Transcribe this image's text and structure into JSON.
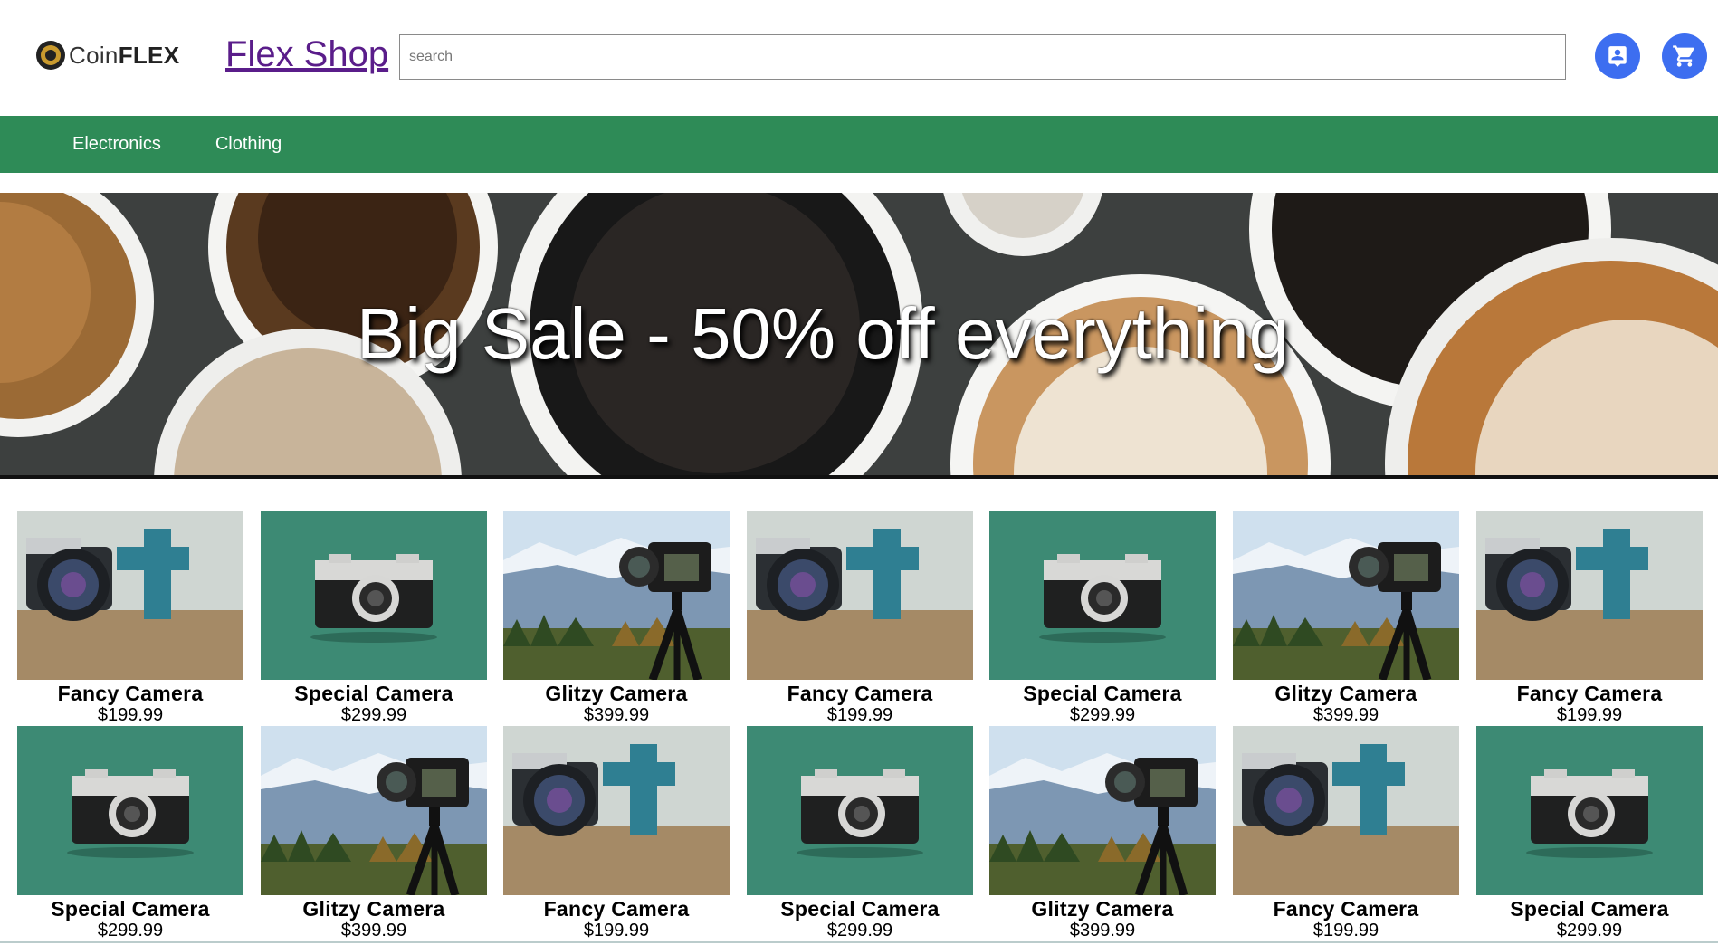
{
  "header": {
    "logo_text_light": "Coin",
    "logo_text_bold": "FLEX",
    "shop_title": "Flex Shop",
    "search_placeholder": "search",
    "account_icon": "account-icon",
    "cart_icon": "cart-icon"
  },
  "nav": {
    "items": [
      {
        "label": "Electronics"
      },
      {
        "label": "Clothing"
      }
    ]
  },
  "banner": {
    "headline": "Big Sale - 50% off everything"
  },
  "colors": {
    "nav_green": "#2e8b57",
    "icon_blue": "#3d6ef0",
    "title_purple": "#5a1d8a"
  },
  "products": [
    {
      "name": "Fancy Camera",
      "price": "$199.99",
      "image": "fancy"
    },
    {
      "name": "Special Camera",
      "price": "$299.99",
      "image": "special"
    },
    {
      "name": "Glitzy Camera",
      "price": "$399.99",
      "image": "glitzy"
    },
    {
      "name": "Fancy Camera",
      "price": "$199.99",
      "image": "fancy"
    },
    {
      "name": "Special Camera",
      "price": "$299.99",
      "image": "special"
    },
    {
      "name": "Glitzy Camera",
      "price": "$399.99",
      "image": "glitzy"
    },
    {
      "name": "Fancy Camera",
      "price": "$199.99",
      "image": "fancy"
    },
    {
      "name": "Special Camera",
      "price": "$299.99",
      "image": "special"
    },
    {
      "name": "Glitzy Camera",
      "price": "$399.99",
      "image": "glitzy"
    },
    {
      "name": "Fancy Camera",
      "price": "$199.99",
      "image": "fancy"
    },
    {
      "name": "Special Camera",
      "price": "$299.99",
      "image": "special"
    },
    {
      "name": "Glitzy Camera",
      "price": "$399.99",
      "image": "glitzy"
    },
    {
      "name": "Fancy Camera",
      "price": "$199.99",
      "image": "fancy"
    },
    {
      "name": "Special Camera",
      "price": "$299.99",
      "image": "special"
    }
  ]
}
